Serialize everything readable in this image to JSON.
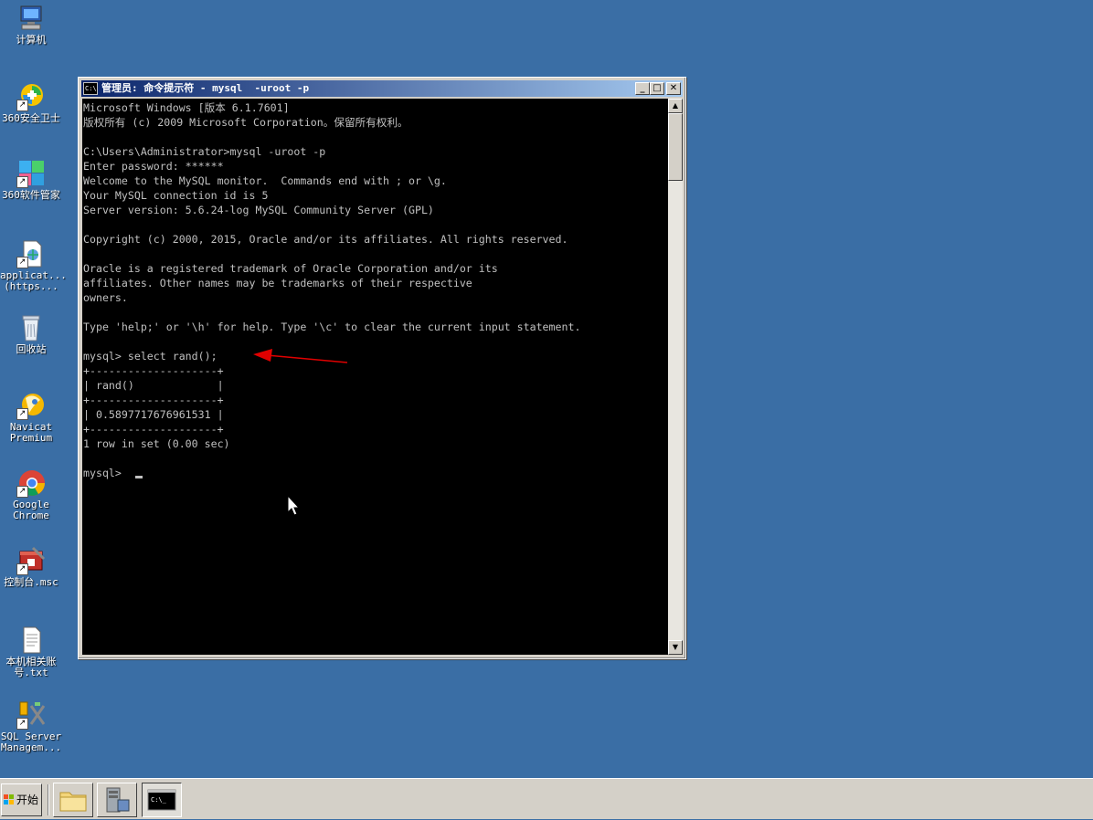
{
  "desktop": {
    "icons": [
      {
        "label": "计算机",
        "icon": "computer-icon"
      },
      {
        "label": "360安全卫士",
        "icon": "360-security-icon"
      },
      {
        "label": "360软件管家",
        "icon": "360-software-icon"
      },
      {
        "label": "applicat...\n(https...",
        "icon": "web-shortcut-icon"
      },
      {
        "label": "回收站",
        "icon": "recycle-bin-icon"
      },
      {
        "label": "Navicat\nPremium",
        "icon": "navicat-icon"
      },
      {
        "label": "Google\nChrome",
        "icon": "chrome-icon"
      },
      {
        "label": "控制台.msc",
        "icon": "console-msc-icon"
      },
      {
        "label": "本机相关账\n号.txt",
        "icon": "text-file-icon"
      },
      {
        "label": "SQL Server\nManagem...",
        "icon": "sql-server-icon"
      }
    ]
  },
  "window": {
    "title": "管理员: 命令提示符 - mysql  -uroot -p",
    "icon_text": "C:\\",
    "buttons": {
      "minimize": "_",
      "maximize": "□",
      "close": "✕"
    },
    "console_lines": [
      "Microsoft Windows [版本 6.1.7601]",
      "版权所有 (c) 2009 Microsoft Corporation。保留所有权利。",
      "",
      "C:\\Users\\Administrator>mysql -uroot -p",
      "Enter password: ******",
      "Welcome to the MySQL monitor.  Commands end with ; or \\g.",
      "Your MySQL connection id is 5",
      "Server version: 5.6.24-log MySQL Community Server (GPL)",
      "",
      "Copyright (c) 2000, 2015, Oracle and/or its affiliates. All rights reserved.",
      "",
      "Oracle is a registered trademark of Oracle Corporation and/or its",
      "affiliates. Other names may be trademarks of their respective",
      "owners.",
      "",
      "Type 'help;' or '\\h' for help. Type '\\c' to clear the current input statement.",
      "",
      "mysql> select rand();",
      "+--------------------+",
      "| rand()             |",
      "+--------------------+",
      "| 0.5897717676961531 |",
      "+--------------------+",
      "1 row in set (0.00 sec)",
      "",
      "mysql> "
    ],
    "scroll": {
      "up": "▲",
      "down": "▼"
    }
  },
  "annotation": {
    "arrow_color": "#e00000"
  },
  "taskbar": {
    "start_label": "开始",
    "tasks": [
      {
        "name": "explorer",
        "icon": "folder-icon"
      },
      {
        "name": "server-manager",
        "icon": "server-manager-icon"
      },
      {
        "name": "cmd",
        "icon": "cmd-icon"
      }
    ]
  }
}
